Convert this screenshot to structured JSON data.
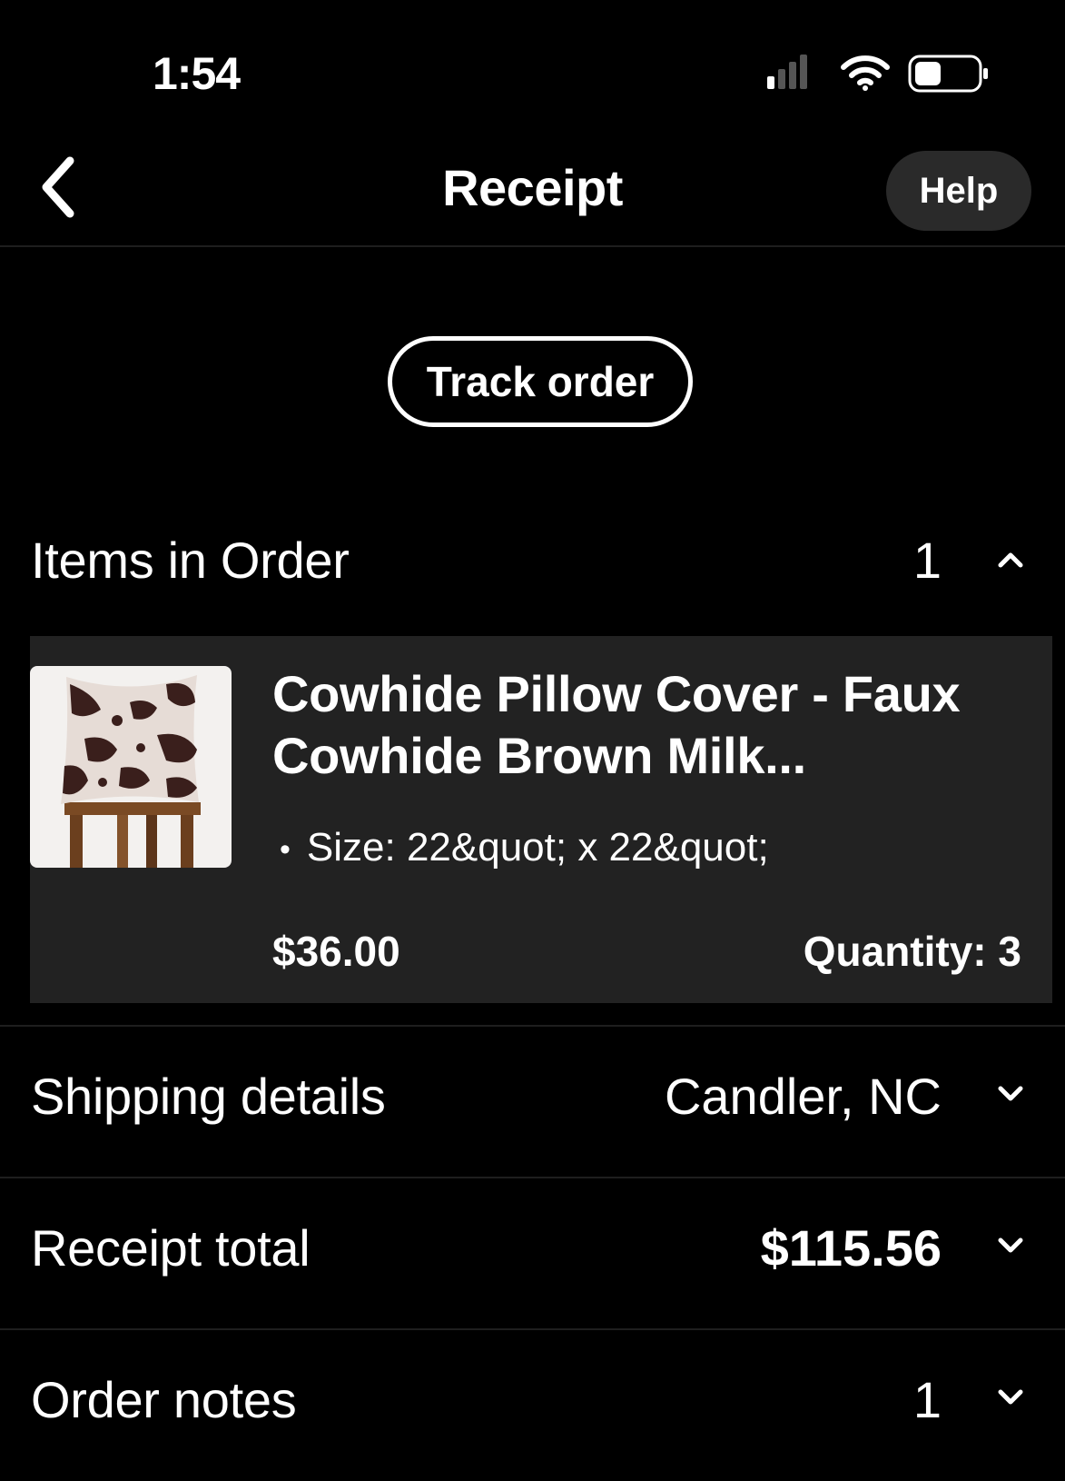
{
  "status_bar": {
    "time": "1:54",
    "icons": [
      "signal-icon",
      "wifi-icon",
      "battery-icon"
    ]
  },
  "nav": {
    "title": "Receipt",
    "help_label": "Help",
    "back_icon": "chevron-left-icon"
  },
  "track_order_label": "Track order",
  "items_section": {
    "label": "Items in Order",
    "count": "1",
    "expanded": true,
    "items": [
      {
        "title": "Cowhide Pillow Cover - Faux Cowhide Brown Milk...",
        "variation": "Size: 22&quot; x 22&quot;",
        "price": "$36.00",
        "quantity": "Quantity: 3",
        "thumbnail": "pillow-thumbnail"
      }
    ]
  },
  "shipping": {
    "label": "Shipping details",
    "value": "Candler, NC"
  },
  "receipt_total": {
    "label": "Receipt total",
    "value": "$115.56"
  },
  "order_notes": {
    "label": "Order notes",
    "value": "1"
  },
  "colors": {
    "background": "#000000",
    "card": "#222222",
    "help_button": "#2a2a2a",
    "text": "#ffffff"
  }
}
